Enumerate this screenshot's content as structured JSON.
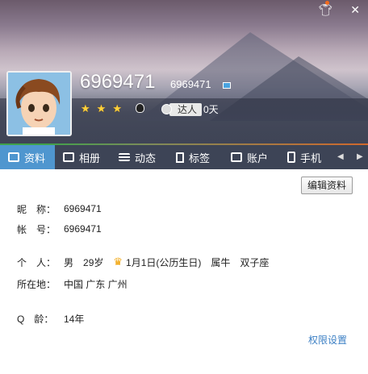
{
  "header": {
    "nickname": "6969471",
    "qq_number": "6969471",
    "talent_label": "达人",
    "days": "0天"
  },
  "tabs": [
    {
      "label": "资料",
      "icon": "profile-card-icon"
    },
    {
      "label": "相册",
      "icon": "photo-album-icon"
    },
    {
      "label": "动态",
      "icon": "feed-list-icon"
    },
    {
      "label": "标签",
      "icon": "bookmark-icon"
    },
    {
      "label": "账户",
      "icon": "briefcase-icon"
    },
    {
      "label": "手机",
      "icon": "phone-icon"
    }
  ],
  "profile": {
    "edit_button": "编辑资料",
    "nickname_label": "昵　称：",
    "nickname_value": "6969471",
    "account_label": "帐　号：",
    "account_value": "6969471",
    "personal_label": "个　人：",
    "gender": "男",
    "age": "29岁",
    "birthday": "1月1日(公历生日)",
    "zodiac": "属牛",
    "constellation": "双子座",
    "location_label": "所在地：",
    "location": "中国 广东 广州",
    "qage_label": "Q　龄：",
    "qage": "14年",
    "permissions_link": "权限设置"
  },
  "colors": {
    "active_tab": "#4f96cf",
    "tab_bar": "#2c3448",
    "link": "#3b7fc4",
    "star": "#ffd23c"
  }
}
